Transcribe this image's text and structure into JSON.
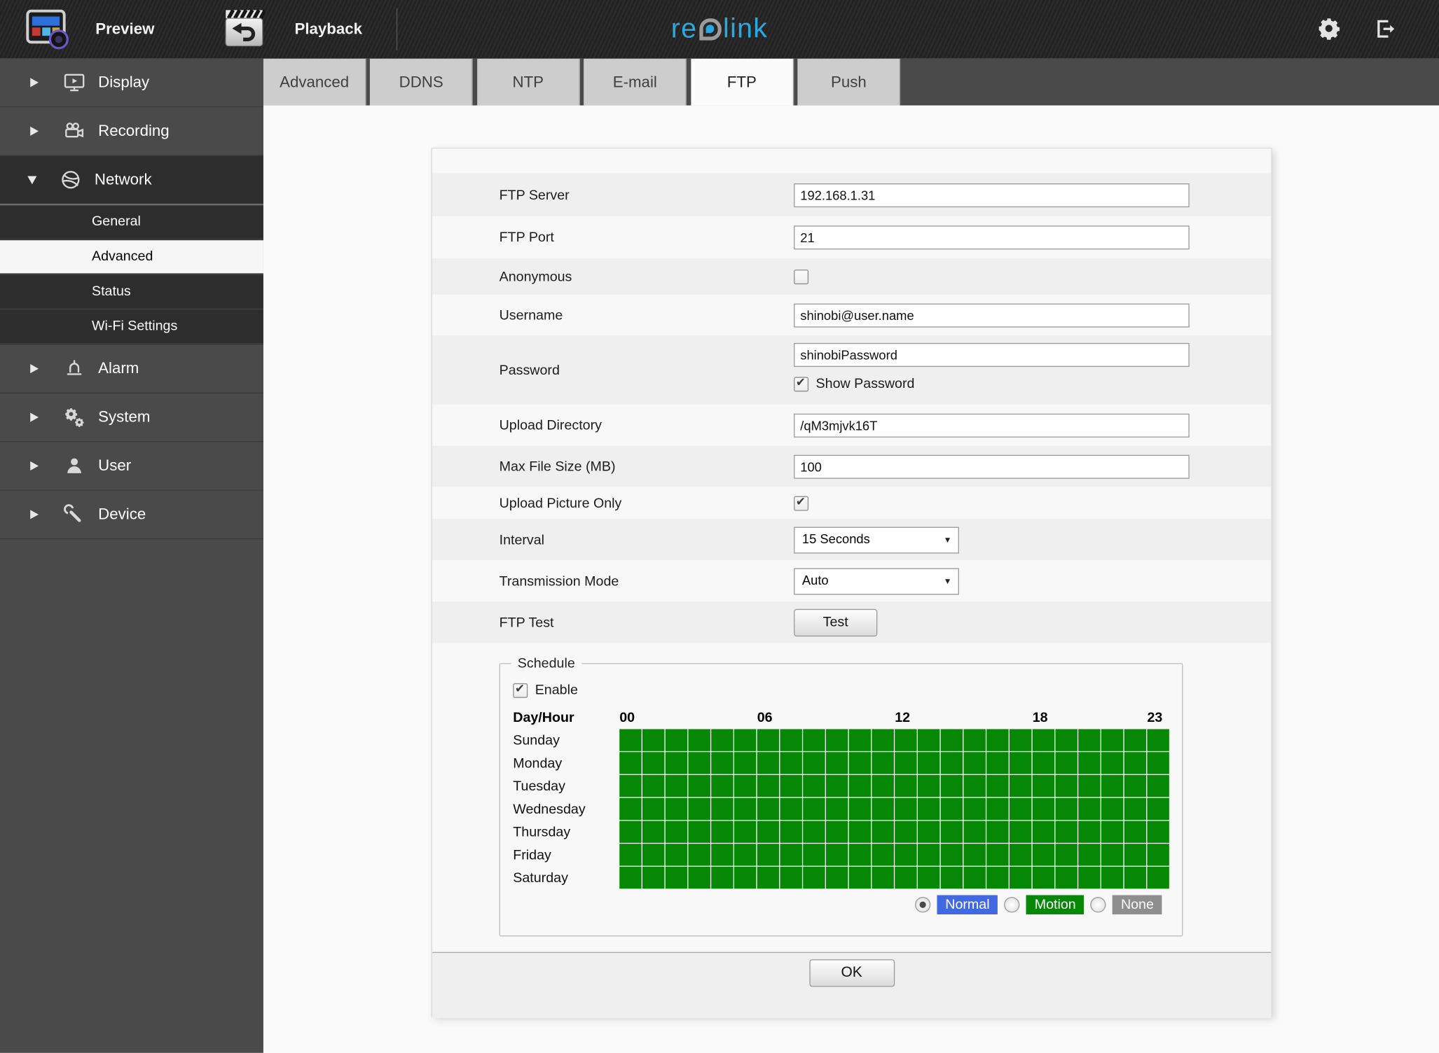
{
  "app": {
    "logo_left": "re",
    "logo_right": "link"
  },
  "topbar": {
    "preview": "Preview",
    "playback": "Playback"
  },
  "icons": {
    "dropdown_arrow": "▼",
    "check": "✔"
  },
  "sidebar": {
    "items": [
      {
        "label": "Display"
      },
      {
        "label": "Recording"
      },
      {
        "label": "Network",
        "expanded": true,
        "children": [
          {
            "label": "General",
            "selected": false
          },
          {
            "label": "Advanced",
            "selected": true
          },
          {
            "label": "Status",
            "selected": false
          },
          {
            "label": "Wi-Fi Settings",
            "selected": false
          }
        ]
      },
      {
        "label": "Alarm"
      },
      {
        "label": "System"
      },
      {
        "label": "User"
      },
      {
        "label": "Device"
      }
    ]
  },
  "tabs": {
    "items": [
      "Advanced",
      "DDNS",
      "NTP",
      "E-mail",
      "FTP",
      "Push"
    ],
    "active": "FTP",
    "active_flags": [
      false,
      false,
      false,
      false,
      true,
      false
    ]
  },
  "form": {
    "rows": {
      "ftp_server": {
        "label": "FTP Server",
        "value": "192.168.1.31"
      },
      "ftp_port": {
        "label": "FTP Port",
        "value": "21"
      },
      "anonymous": {
        "label": "Anonymous",
        "checked": false
      },
      "username": {
        "label": "Username",
        "value": "shinobi@user.name"
      },
      "password": {
        "label": "Password",
        "value": "shinobiPassword",
        "show_label": "Show Password",
        "show_checked": true
      },
      "upload_directory": {
        "label": "Upload Directory",
        "value": "/qM3mjvk16T"
      },
      "max_file_size": {
        "label": "Max File Size (MB)",
        "value": "100"
      },
      "upload_picture_only": {
        "label": "Upload Picture Only",
        "checked": true
      },
      "interval": {
        "label": "Interval",
        "value": "15 Seconds"
      },
      "transmission_mode": {
        "label": "Transmission Mode",
        "value": "Auto"
      },
      "ftp_test": {
        "label": "FTP Test",
        "button_label": "Test"
      }
    }
  },
  "schedule": {
    "legend": "Schedule",
    "enable_label": "Enable",
    "enable_checked": true,
    "corner_label": "Day/Hour",
    "hour_labels": [
      "00",
      "06",
      "12",
      "18",
      "23"
    ],
    "hour_label_columns": [
      0,
      6,
      12,
      18,
      23
    ],
    "days": [
      "Sunday",
      "Monday",
      "Tuesday",
      "Wednesday",
      "Thursday",
      "Friday",
      "Saturday"
    ],
    "hours_per_day": 24,
    "all_cells_state": "motion",
    "cell_colors": {
      "normal": "#4169E1",
      "motion": "#068806",
      "none": "#8e8e8e"
    },
    "modes": [
      {
        "label": "Normal",
        "selected": true,
        "color": "#4169E1"
      },
      {
        "label": "Motion",
        "selected": false,
        "color": "#068806"
      },
      {
        "label": "None",
        "selected": false,
        "color": "#8e8e8e"
      }
    ]
  },
  "ok_label": "OK",
  "colors": {
    "topbar_bg": "#272727",
    "sidebar_bg": "#4a4a4a",
    "sidebar_expanded_bg": "#2d2d2d",
    "selected_item_bg": "#f6f6f6",
    "accent_blue": "#2aa8e0",
    "schedule_green": "#068806",
    "normal_blue": "#4169E1",
    "none_gray": "#8e8e8e",
    "panel_bg": "#f8f8f8",
    "row_alt_bg": "#efefef"
  }
}
